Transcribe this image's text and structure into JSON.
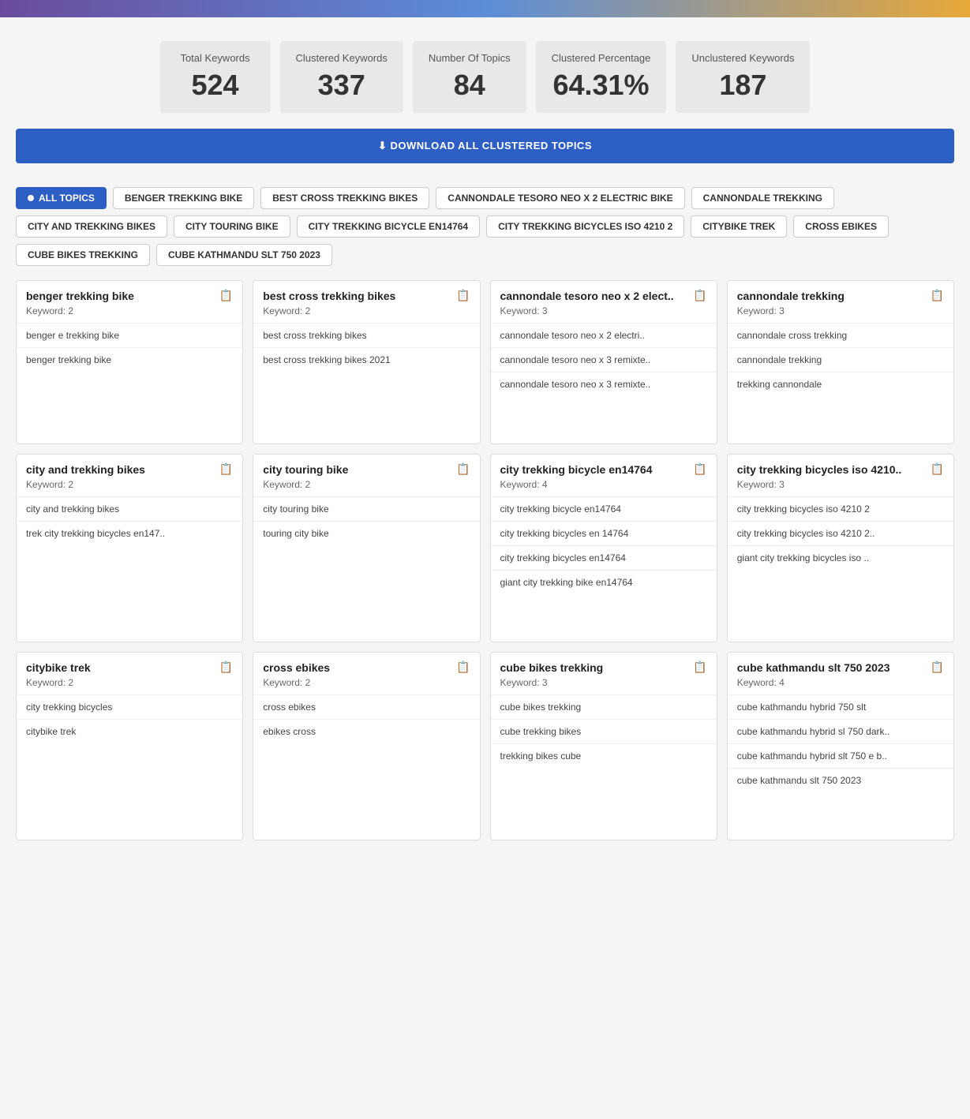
{
  "header": {
    "gradient": "purple to blue to gold"
  },
  "stats": [
    {
      "label": "Total Keywords",
      "value": "524"
    },
    {
      "label": "Clustered Keywords",
      "value": "337"
    },
    {
      "label": "Number Of Topics",
      "value": "84"
    },
    {
      "label": "Clustered Percentage",
      "value": "64.31%"
    },
    {
      "label": "Unclustered Keywords",
      "value": "187"
    }
  ],
  "download_btn": "⬇ DOWNLOAD ALL CLUSTERED TOPICS",
  "filter_tags": [
    {
      "label": "ALL TOPICS",
      "active": true
    },
    {
      "label": "BENGER TREKKING BIKE",
      "active": false
    },
    {
      "label": "BEST CROSS TREKKING BIKES",
      "active": false
    },
    {
      "label": "CANNONDALE TESORO NEO X 2 ELECTRIC BIKE",
      "active": false
    },
    {
      "label": "CANNONDALE TREKKING",
      "active": false
    },
    {
      "label": "CITY AND TREKKING BIKES",
      "active": false
    },
    {
      "label": "CITY TOURING BIKE",
      "active": false
    },
    {
      "label": "CITY TREKKING BICYCLE EN14764",
      "active": false
    },
    {
      "label": "CITY TREKKING BICYCLES ISO 4210 2",
      "active": false
    },
    {
      "label": "CITYBIKE TREK",
      "active": false
    },
    {
      "label": "CROSS EBIKES",
      "active": false
    },
    {
      "label": "CUBE BIKES TREKKING",
      "active": false
    },
    {
      "label": "CUBE KATHMANDU SLT 750 2023",
      "active": false
    }
  ],
  "cards": [
    {
      "title": "benger trekking bike",
      "keyword_count": "Keyword: 2",
      "items": [
        "benger e trekking bike",
        "benger trekking bike"
      ]
    },
    {
      "title": "best cross trekking bikes",
      "keyword_count": "Keyword: 2",
      "items": [
        "best cross trekking bikes",
        "best cross trekking bikes 2021"
      ]
    },
    {
      "title": "cannondale tesoro neo x 2 elect..",
      "keyword_count": "Keyword: 3",
      "items": [
        "cannondale tesoro neo x 2 electri..",
        "cannondale tesoro neo x 3 remixte..",
        "cannondale tesoro neo x 3 remixte.."
      ]
    },
    {
      "title": "cannondale trekking",
      "keyword_count": "Keyword: 3",
      "items": [
        "cannondale cross trekking",
        "cannondale trekking",
        "trekking cannondale"
      ]
    },
    {
      "title": "city and trekking bikes",
      "keyword_count": "Keyword: 2",
      "items": [
        "city and trekking bikes",
        "trek city trekking bicycles en147.."
      ]
    },
    {
      "title": "city touring bike",
      "keyword_count": "Keyword: 2",
      "items": [
        "city touring bike",
        "touring city bike"
      ]
    },
    {
      "title": "city trekking bicycle en14764",
      "keyword_count": "Keyword: 4",
      "items": [
        "city trekking bicycle en14764",
        "city trekking bicycles en 14764",
        "city trekking bicycles en14764",
        "giant city trekking bike en14764"
      ]
    },
    {
      "title": "city trekking bicycles iso 4210..",
      "keyword_count": "Keyword: 3",
      "items": [
        "city trekking bicycles iso 4210 2",
        "city trekking bicycles iso 4210 2..",
        "giant city trekking bicycles iso .."
      ]
    },
    {
      "title": "citybike trek",
      "keyword_count": "Keyword: 2",
      "items": [
        "city trekking bicycles",
        "citybike trek"
      ]
    },
    {
      "title": "cross ebikes",
      "keyword_count": "Keyword: 2",
      "items": [
        "cross ebikes",
        "ebikes cross"
      ]
    },
    {
      "title": "cube bikes trekking",
      "keyword_count": "Keyword: 3",
      "items": [
        "cube bikes trekking",
        "cube trekking bikes",
        "trekking bikes cube"
      ]
    },
    {
      "title": "cube kathmandu slt 750 2023",
      "keyword_count": "Keyword: 4",
      "items": [
        "cube kathmandu hybrid 750 slt",
        "cube kathmandu hybrid sl 750 dark..",
        "cube kathmandu hybrid slt 750 e b..",
        "cube kathmandu slt 750 2023"
      ]
    }
  ]
}
